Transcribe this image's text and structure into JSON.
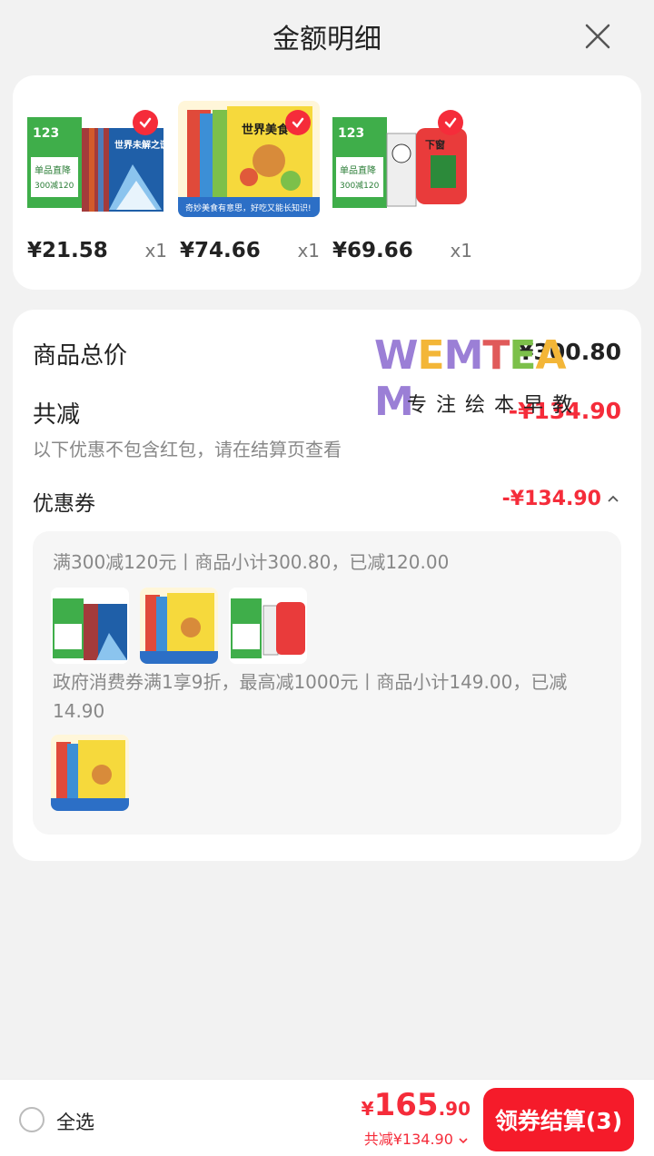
{
  "header": {
    "title": "金额明细"
  },
  "products": [
    {
      "price": "¥21.58",
      "qty": "x1",
      "image": "book-set-world-mysteries"
    },
    {
      "price": "¥74.66",
      "qty": "x1",
      "image": "book-set-world-food-comics"
    },
    {
      "price": "¥69.66",
      "qty": "x1",
      "image": "book-set-comic-stories"
    }
  ],
  "summary": {
    "total_label": "商品总价",
    "total_value": "¥300.80",
    "reduce_label": "共减",
    "reduce_value": "-¥134.90",
    "reduce_note": "以下优惠不包含红包，请在结算页查看",
    "coupon_label": "优惠券",
    "coupon_value": "-¥134.90"
  },
  "coupons": [
    {
      "text": "满300减120元丨商品小计300.80，已减120.00"
    },
    {
      "text": "政府消费券满1享9折，最高减1000元丨商品小计149.00，已减14.90"
    }
  ],
  "watermark": {
    "logo": "WEMTEAM",
    "sub": "专注绘本早教"
  },
  "footer": {
    "select_all": "全选",
    "price_currency": "¥",
    "price_int": "165",
    "price_dec": ".90",
    "discount": "共减¥134.90",
    "checkout": "领券结算(3)"
  },
  "colors": {
    "accent": "#f52c3a",
    "button": "#f51b2a"
  }
}
